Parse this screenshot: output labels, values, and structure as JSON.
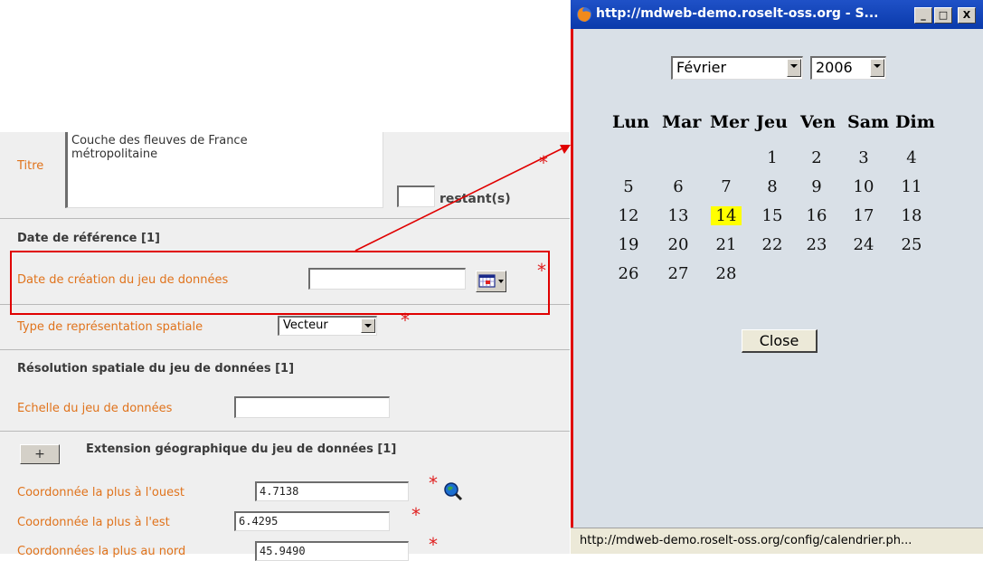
{
  "form": {
    "title_label": "Titre",
    "title_value_line1": "Couche des fleuves de France",
    "title_value_line2": "métropolitaine",
    "remaining_label": "restant(s)",
    "section_reference_date": "Date de référence [1]",
    "creation_date_label": "Date de création du jeu de données",
    "creation_date_value": "",
    "spatial_type_label": "Type de représentation spatiale",
    "spatial_type_value": "Vecteur",
    "section_resolution": "Résolution spatiale du jeu de données [1]",
    "scale_label": "Echelle du jeu de données",
    "scale_value": "",
    "expand_button": "+",
    "section_extent": "Extension géographique du jeu de données [1]",
    "west_label": "Coordonnée la plus à l'ouest",
    "west_value": "4.7138",
    "east_label": "Coordonnée la plus à l'est",
    "east_value": "6.4295",
    "north_label": "Coordonnées la plus au nord",
    "north_value": "45.9490",
    "required_mark": "*"
  },
  "popup": {
    "title": "http://mdweb-demo.roselt-oss.org - S...",
    "month_selected": "Février",
    "year_selected": "2006",
    "weekdays": [
      "Lun",
      "Mar",
      "Mer",
      "Jeu",
      "Ven",
      "Sam",
      "Dim"
    ],
    "weeks": [
      [
        "",
        "",
        "",
        "1",
        "2",
        "3",
        "4"
      ],
      [
        "5",
        "6",
        "7",
        "8",
        "9",
        "10",
        "11"
      ],
      [
        "12",
        "13",
        "14",
        "15",
        "16",
        "17",
        "18"
      ],
      [
        "19",
        "20",
        "21",
        "22",
        "23",
        "24",
        "25"
      ],
      [
        "26",
        "27",
        "28",
        "",
        "",
        "",
        ""
      ]
    ],
    "highlighted_day": "14",
    "close_label": "Close",
    "status_text": "http://mdweb-demo.roselt-oss.org/config/calendrier.ph..."
  },
  "colors": {
    "label_orange": "#e0731c",
    "required_red": "#e02020",
    "annotation_red": "#e00000",
    "today_highlight": "#ffff00",
    "titlebar_blue": "#0a3aab"
  }
}
